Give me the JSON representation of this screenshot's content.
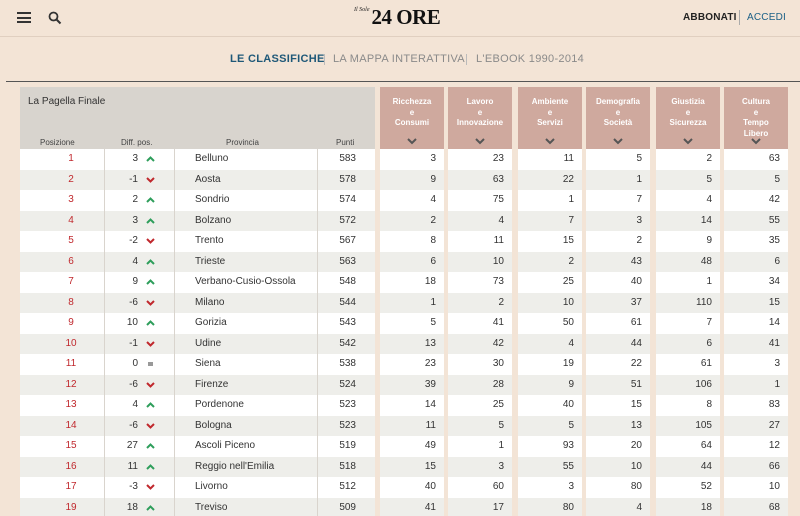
{
  "header": {
    "logo_small": "Il Sole",
    "logo_big": "24 ORE",
    "subscribe": "ABBONATI",
    "login": "ACCEDI",
    "icons": [
      "menu-icon",
      "search-icon"
    ]
  },
  "nav": {
    "items": [
      {
        "label": "LE CLASSIFICHE",
        "active": true
      },
      {
        "label": "LA MAPPA INTERATTIVA",
        "active": false
      },
      {
        "label": "L'EBOOK 1990-2014",
        "active": false
      }
    ]
  },
  "table": {
    "title": "La Pagella Finale",
    "columns": {
      "position": "Posizione",
      "diff": "Diff. pos.",
      "province": "Provincia",
      "points": "Punti"
    },
    "categories": [
      {
        "lines": [
          "Ricchezza",
          "e",
          "Consumi"
        ]
      },
      {
        "lines": [
          "Lavoro",
          "e",
          "Innovazione"
        ]
      },
      {
        "lines": [
          "Ambiente",
          "e",
          "Servizi"
        ]
      },
      {
        "lines": [
          "Demografia",
          "e",
          "Società"
        ]
      },
      {
        "lines": [
          "Giustizia",
          "e",
          "Sicurezza"
        ]
      },
      {
        "lines": [
          "Cultura",
          "e",
          "Tempo",
          "Libero"
        ]
      }
    ],
    "colors": {
      "header_bg": "#cfa99e",
      "up": "#2e9e5b",
      "down": "#c0282d",
      "position_text": "#c0282d"
    },
    "rows": [
      {
        "pos": "1",
        "diff": "3",
        "trend": "up",
        "province": "Belluno",
        "points": "583",
        "scores": [
          "3",
          "23",
          "11",
          "5",
          "2",
          "63"
        ]
      },
      {
        "pos": "2",
        "diff": "-1",
        "trend": "down",
        "province": "Aosta",
        "points": "578",
        "scores": [
          "9",
          "63",
          "22",
          "1",
          "5",
          "5"
        ]
      },
      {
        "pos": "3",
        "diff": "2",
        "trend": "up",
        "province": "Sondrio",
        "points": "574",
        "scores": [
          "4",
          "75",
          "1",
          "7",
          "4",
          "42"
        ]
      },
      {
        "pos": "4",
        "diff": "3",
        "trend": "up",
        "province": "Bolzano",
        "points": "572",
        "scores": [
          "2",
          "4",
          "7",
          "3",
          "14",
          "55"
        ]
      },
      {
        "pos": "5",
        "diff": "-2",
        "trend": "down",
        "province": "Trento",
        "points": "567",
        "scores": [
          "8",
          "11",
          "15",
          "2",
          "9",
          "35"
        ]
      },
      {
        "pos": "6",
        "diff": "4",
        "trend": "up",
        "province": "Trieste",
        "points": "563",
        "scores": [
          "6",
          "10",
          "2",
          "43",
          "48",
          "6"
        ]
      },
      {
        "pos": "7",
        "diff": "9",
        "trend": "up",
        "province": "Verbano-Cusio-Ossola",
        "points": "548",
        "scores": [
          "18",
          "73",
          "25",
          "40",
          "1",
          "34"
        ]
      },
      {
        "pos": "8",
        "diff": "-6",
        "trend": "down",
        "province": "Milano",
        "points": "544",
        "scores": [
          "1",
          "2",
          "10",
          "37",
          "110",
          "15"
        ]
      },
      {
        "pos": "9",
        "diff": "10",
        "trend": "up",
        "province": "Gorizia",
        "points": "543",
        "scores": [
          "5",
          "41",
          "50",
          "61",
          "7",
          "14"
        ]
      },
      {
        "pos": "10",
        "diff": "-1",
        "trend": "down",
        "province": "Udine",
        "points": "542",
        "scores": [
          "13",
          "42",
          "4",
          "44",
          "6",
          "41"
        ]
      },
      {
        "pos": "11",
        "diff": "0",
        "trend": "same",
        "province": "Siena",
        "points": "538",
        "scores": [
          "23",
          "30",
          "19",
          "22",
          "61",
          "3"
        ]
      },
      {
        "pos": "12",
        "diff": "-6",
        "trend": "down",
        "province": "Firenze",
        "points": "524",
        "scores": [
          "39",
          "28",
          "9",
          "51",
          "106",
          "1"
        ]
      },
      {
        "pos": "13",
        "diff": "4",
        "trend": "up",
        "province": "Pordenone",
        "points": "523",
        "scores": [
          "14",
          "25",
          "40",
          "15",
          "8",
          "83"
        ]
      },
      {
        "pos": "14",
        "diff": "-6",
        "trend": "down",
        "province": "Bologna",
        "points": "523",
        "scores": [
          "11",
          "5",
          "5",
          "13",
          "105",
          "27"
        ]
      },
      {
        "pos": "15",
        "diff": "27",
        "trend": "up",
        "province": "Ascoli Piceno",
        "points": "519",
        "scores": [
          "49",
          "1",
          "93",
          "20",
          "64",
          "12"
        ]
      },
      {
        "pos": "16",
        "diff": "11",
        "trend": "up",
        "province": "Reggio nell'Emilia",
        "points": "518",
        "scores": [
          "15",
          "3",
          "55",
          "10",
          "44",
          "66"
        ]
      },
      {
        "pos": "17",
        "diff": "-3",
        "trend": "down",
        "province": "Livorno",
        "points": "512",
        "scores": [
          "40",
          "60",
          "3",
          "80",
          "52",
          "10"
        ]
      },
      {
        "pos": "19",
        "diff": "18",
        "trend": "up",
        "province": "Treviso",
        "points": "509",
        "scores": [
          "41",
          "17",
          "80",
          "4",
          "18",
          "68"
        ]
      }
    ]
  }
}
